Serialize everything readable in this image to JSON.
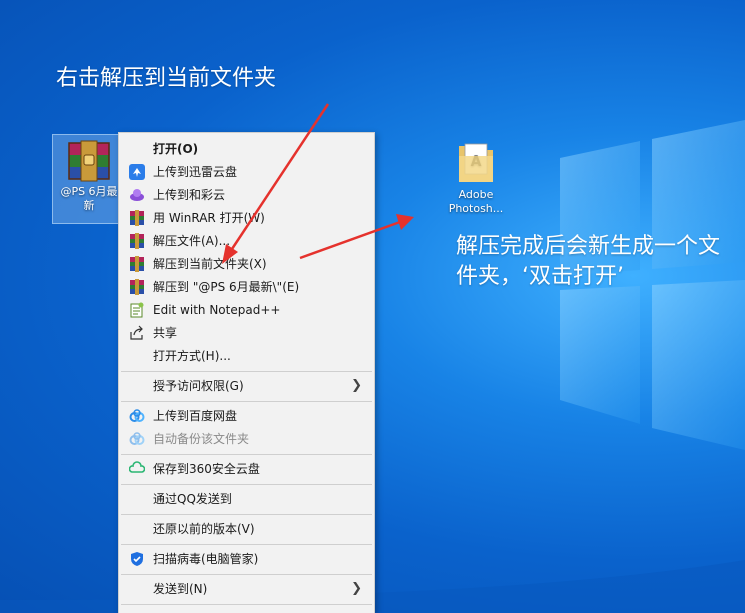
{
  "annotations": {
    "step1": "右击解压到当前文件夹",
    "step2": "解压完成后会新生成一个文件夹，‘双击打开’"
  },
  "desktop_icons": {
    "archive": {
      "label_line1": "@PS 6月最",
      "label_line2": "新"
    },
    "folder": {
      "label_line1": "Adobe",
      "label_line2": "Photosh..."
    }
  },
  "context_menu": {
    "items": [
      {
        "label": "打开(O)",
        "icon": "none"
      },
      {
        "label": "上传到迅雷云盘",
        "icon": "thunder-cloud-icon"
      },
      {
        "label": "上传到和彩云",
        "icon": "hecaiyun-icon"
      },
      {
        "label": "用 WinRAR 打开(W)",
        "icon": "winrar-icon"
      },
      {
        "label": "解压文件(A)...",
        "icon": "winrar-icon"
      },
      {
        "label": "解压到当前文件夹(X)",
        "icon": "winrar-icon"
      },
      {
        "label": "解压到 \"@PS 6月最新\\\"(E)",
        "icon": "winrar-icon"
      },
      {
        "label": "Edit with Notepad++",
        "icon": "notepad-plus-plus-icon"
      },
      {
        "label": "共享",
        "icon": "share-icon"
      },
      {
        "label": "打开方式(H)...",
        "icon": "none"
      },
      {
        "label": "授予访问权限(G)",
        "icon": "none"
      },
      {
        "label": "上传到百度网盘",
        "icon": "baidu-netdisk-icon"
      },
      {
        "label": "自动备份该文件夹",
        "icon": "baidu-netdisk-icon"
      },
      {
        "label": "保存到360安全云盘",
        "icon": "cloud-360-icon"
      },
      {
        "label": "通过QQ发送到",
        "icon": "none"
      },
      {
        "label": "还原以前的版本(V)",
        "icon": "none"
      },
      {
        "label": "扫描病毒(电脑管家)",
        "icon": "tencent-shield-icon"
      },
      {
        "label": "发送到(N)",
        "icon": "none"
      }
    ]
  },
  "colors": {
    "annotation_arrow": "#e5322d",
    "menu_background": "#f2f2f2"
  }
}
